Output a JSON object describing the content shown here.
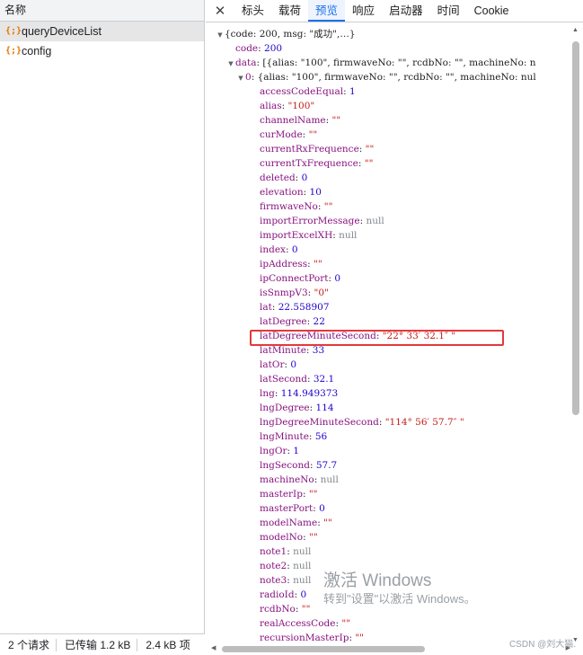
{
  "left": {
    "header": "名称",
    "requests": [
      {
        "icon": "{;}",
        "name": "queryDeviceList",
        "selected": true
      },
      {
        "icon": "{;}",
        "name": "config",
        "selected": false
      }
    ],
    "status": [
      "2 个请求",
      "已传输 1.2 kB",
      "2.4 kB 项"
    ]
  },
  "tabs": {
    "close": "✕",
    "items": [
      "标头",
      "载荷",
      "预览",
      "响应",
      "启动器",
      "时间",
      "Cookie"
    ],
    "active": "预览"
  },
  "preview": {
    "root_summary": "{code: 200, msg: \"成功\",…}",
    "data_summary": "[{alias: \"100\", firmwaveNo: \"\", rcdbNo: \"\", machineNo: n",
    "item0_summary": "{alias: \"100\", firmwaveNo: \"\", rcdbNo: \"\", machineNo: nul",
    "code_key": "code",
    "code_val": "200",
    "data_key": "data",
    "item0_key": "0",
    "fields": [
      {
        "k": "accessCodeEqual",
        "v": "1",
        "t": "n"
      },
      {
        "k": "alias",
        "v": "\"100\"",
        "t": "s"
      },
      {
        "k": "channelName",
        "v": "\"\"",
        "t": "s"
      },
      {
        "k": "curMode",
        "v": "\"\"",
        "t": "s"
      },
      {
        "k": "currentRxFrequence",
        "v": "\"\"",
        "t": "s"
      },
      {
        "k": "currentTxFrequence",
        "v": "\"\"",
        "t": "s"
      },
      {
        "k": "deleted",
        "v": "0",
        "t": "n"
      },
      {
        "k": "elevation",
        "v": "10",
        "t": "n"
      },
      {
        "k": "firmwaveNo",
        "v": "\"\"",
        "t": "s"
      },
      {
        "k": "importErrorMessage",
        "v": "null",
        "t": "nl"
      },
      {
        "k": "importExcelXH",
        "v": "null",
        "t": "nl"
      },
      {
        "k": "index",
        "v": "0",
        "t": "n"
      },
      {
        "k": "ipAddress",
        "v": "\"\"",
        "t": "s"
      },
      {
        "k": "ipConnectPort",
        "v": "0",
        "t": "n"
      },
      {
        "k": "isSnmpV3",
        "v": "\"0\"",
        "t": "s"
      },
      {
        "k": "lat",
        "v": "22.558907",
        "t": "n"
      },
      {
        "k": "latDegree",
        "v": "22",
        "t": "n"
      },
      {
        "k": "latDegreeMinuteSecond",
        "v": "\"22° 33′ 32.1″ \"",
        "t": "s"
      },
      {
        "k": "latMinute",
        "v": "33",
        "t": "n"
      },
      {
        "k": "latOr",
        "v": "0",
        "t": "n"
      },
      {
        "k": "latSecond",
        "v": "32.1",
        "t": "n"
      },
      {
        "k": "lng",
        "v": "114.949373",
        "t": "n"
      },
      {
        "k": "lngDegree",
        "v": "114",
        "t": "n"
      },
      {
        "k": "lngDegreeMinuteSecond",
        "v": "\"114° 56′ 57.7″ \"",
        "t": "s"
      },
      {
        "k": "lngMinute",
        "v": "56",
        "t": "n"
      },
      {
        "k": "lngOr",
        "v": "1",
        "t": "n"
      },
      {
        "k": "lngSecond",
        "v": "57.7",
        "t": "n"
      },
      {
        "k": "machineNo",
        "v": "null",
        "t": "nl"
      },
      {
        "k": "masterIp",
        "v": "\"\"",
        "t": "s"
      },
      {
        "k": "masterPort",
        "v": "0",
        "t": "n"
      },
      {
        "k": "modelName",
        "v": "\"\"",
        "t": "s"
      },
      {
        "k": "modelNo",
        "v": "\"\"",
        "t": "s"
      },
      {
        "k": "note1",
        "v": "null",
        "t": "nl"
      },
      {
        "k": "note2",
        "v": "null",
        "t": "nl"
      },
      {
        "k": "note3",
        "v": "null",
        "t": "nl"
      },
      {
        "k": "radioId",
        "v": "0",
        "t": "n"
      },
      {
        "k": "rcdbNo",
        "v": "\"\"",
        "t": "s"
      },
      {
        "k": "realAccessCode",
        "v": "\"\"",
        "t": "s"
      },
      {
        "k": "recursionMasterIp",
        "v": "\"\"",
        "t": "s"
      }
    ]
  },
  "watermark": {
    "title": "激活 Windows",
    "subtitle": "转到\"设置\"以激活 Windows。",
    "csdn": "CSDN @刘大猫."
  }
}
